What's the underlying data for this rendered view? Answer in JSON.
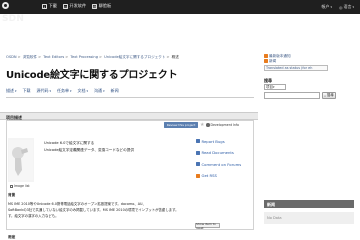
{
  "top_nav": {
    "logo_text": "OSDN",
    "items": [
      {
        "icon": "download-icon",
        "label": "下載"
      },
      {
        "icon": "folder-icon",
        "label": "开发软件"
      },
      {
        "icon": "comment-icon",
        "label": "聊脸板"
      }
    ],
    "right_items": [
      {
        "label": "帳户"
      },
      {
        "label": "语言"
      }
    ]
  },
  "breadcrumb": [
    "OSDN",
    "浏覧软件",
    "Text Editors",
    "Text Processing",
    "Unicode絵文字に関するプロジェクト",
    "概述"
  ],
  "page_title": "Unicode絵文字に関するプロジェクト",
  "tabs": [
    {
      "label": "描述"
    },
    {
      "label": "下载"
    },
    {
      "label": "源代码"
    },
    {
      "label": "任务单"
    },
    {
      "label": "文档"
    },
    {
      "label": "沟通"
    },
    {
      "label": "新闻"
    }
  ],
  "sidebar": {
    "rss_link": "最新版本通知",
    "rss_link_extra": "新闻",
    "language_button": "Translated as status (for eh",
    "search_label": "搜尋",
    "search_select": "项目",
    "search_button": "搜尋"
  },
  "description": {
    "header": "项目描述",
    "review_button": "Review this project",
    "development_info": "Development Info",
    "thumb_label": "Image list",
    "lines": [
      "Unicode 6.0で絵文字に関する",
      "Unicode絵文字定義関連データ、変換コードなどの提供"
    ],
    "section_heading": "背景",
    "body_lines": [
      "MS IME 2010等やUnicode 6.0携帯電話絵文字のオープン拡張提案です。docomo、AU、",
      "SoftBankの3社で共通していない絵文字のみ掲載しています。MS IME 2010の環境でインプットが苦慮します。",
      "す。絵文字の漢字の入力なども。"
    ],
    "more_button": "Show item to reset",
    "section_heading2": "用途"
  },
  "actions": [
    {
      "icon": "bug-icon",
      "label": "Report Bugs"
    },
    {
      "icon": "document-icon",
      "label": "Read Documents"
    },
    {
      "icon": "forum-icon",
      "label": "Comment on Forums"
    },
    {
      "icon": "rss-icon",
      "label": "Get RSS"
    }
  ],
  "news": {
    "header": "新闻",
    "empty_text": "No Data"
  },
  "colors": {
    "topbar": "#1f1f1f",
    "link": "#3f5b86",
    "review_button": "#5b7fb0",
    "news_header": "#6a6a6a"
  }
}
